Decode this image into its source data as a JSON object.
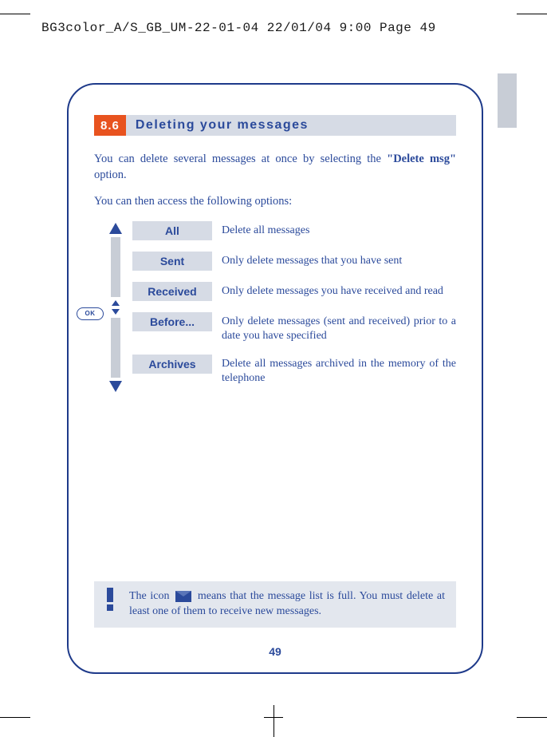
{
  "print_header": {
    "file": "BG3color_A/S_GB_UM-22-01-04",
    "date": "22/01/04",
    "time": "9:00",
    "page": "Page 49"
  },
  "section": {
    "number": "8.6",
    "title": "Deleting your messages"
  },
  "intro": {
    "p1_a": "You can delete several messages at once by selecting the ",
    "p1_b": "\"Delete msg\"",
    "p1_c": " option.",
    "p2": "You can then access the following options:"
  },
  "ok_label": "OK",
  "options": [
    {
      "label": "All",
      "desc": "Delete all messages"
    },
    {
      "label": "Sent",
      "desc": "Only delete messages that you have sent"
    },
    {
      "label": "Received",
      "desc": "Only delete messages you have received and read"
    },
    {
      "label": "Before...",
      "desc": "Only delete messages (sent and received) prior to a date you have specified"
    },
    {
      "label": "Archives",
      "desc": "Delete all messages archived in the memory of the telephone"
    }
  ],
  "note": {
    "a": "The icon ",
    "b": " means that the message list is full. You must delete at least one of them to receive new messages."
  },
  "page_number": "49"
}
